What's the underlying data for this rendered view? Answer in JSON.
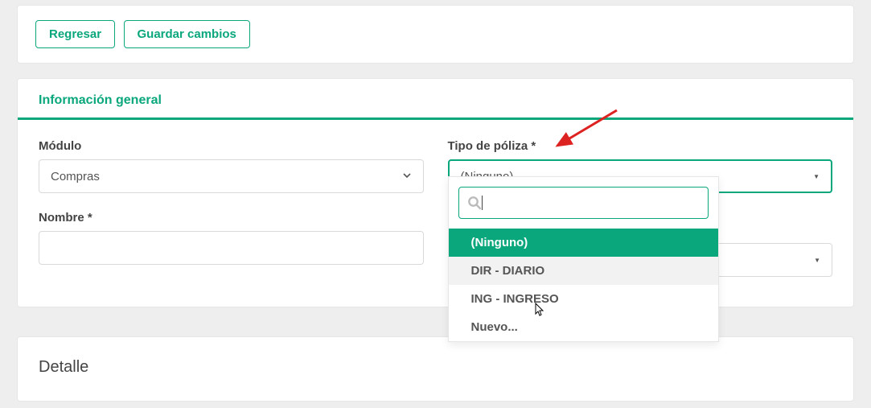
{
  "buttons": {
    "back": "Regresar",
    "save": "Guardar cambios"
  },
  "section_title": "Información general",
  "form": {
    "modulo": {
      "label": "Módulo",
      "value": "Compras"
    },
    "tipo_poliza": {
      "label": "Tipo de póliza *",
      "value": "(Ninguno)"
    },
    "nombre": {
      "label": "Nombre *",
      "value": ""
    }
  },
  "dropdown": {
    "search_value": "",
    "items": {
      "i0": "(Ninguno)",
      "i1": "DIR - DIARIO",
      "i2": "ING - INGRESO",
      "i3": "Nuevo..."
    }
  },
  "detalle_title": "Detalle"
}
